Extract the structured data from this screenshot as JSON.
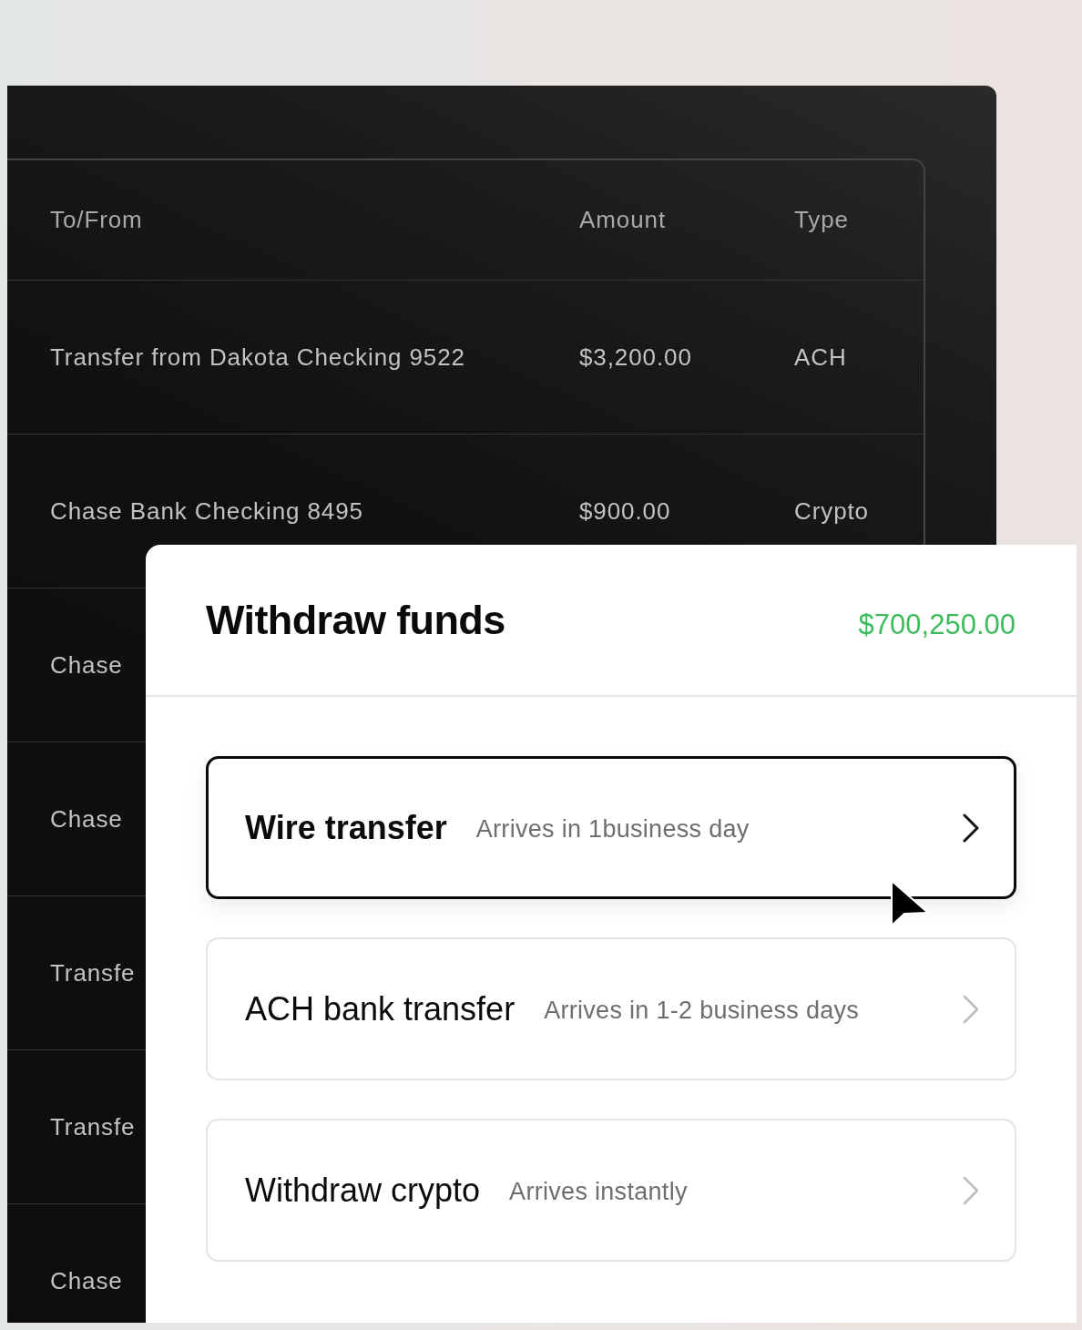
{
  "transactions_table": {
    "columns": [
      "To/From",
      "Amount",
      "Type"
    ],
    "rows": [
      {
        "cells": [
          "Transfer from Dakota Checking 9522",
          "$3,200.00",
          "ACH"
        ]
      },
      {
        "cells": [
          "Chase Bank Checking 8495",
          "$900.00",
          "Crypto"
        ]
      },
      {
        "cells": [
          "Chase"
        ]
      },
      {
        "cells": [
          "Chase"
        ]
      },
      {
        "cells": [
          "Transfe"
        ]
      },
      {
        "cells": [
          "Transfe"
        ]
      },
      {
        "cells": [
          "Chase"
        ]
      }
    ]
  },
  "withdraw_dialog": {
    "title": "Withdraw funds",
    "balance": "$700,250.00",
    "options": [
      {
        "title": "Wire transfer",
        "subtitle": "Arrives in 1business day",
        "selected": true
      },
      {
        "title": "ACH bank transfer",
        "subtitle": "Arrives in 1-2 business days",
        "selected": false
      },
      {
        "title": "Withdraw crypto",
        "subtitle": "Arrives instantly",
        "selected": false
      }
    ]
  }
}
